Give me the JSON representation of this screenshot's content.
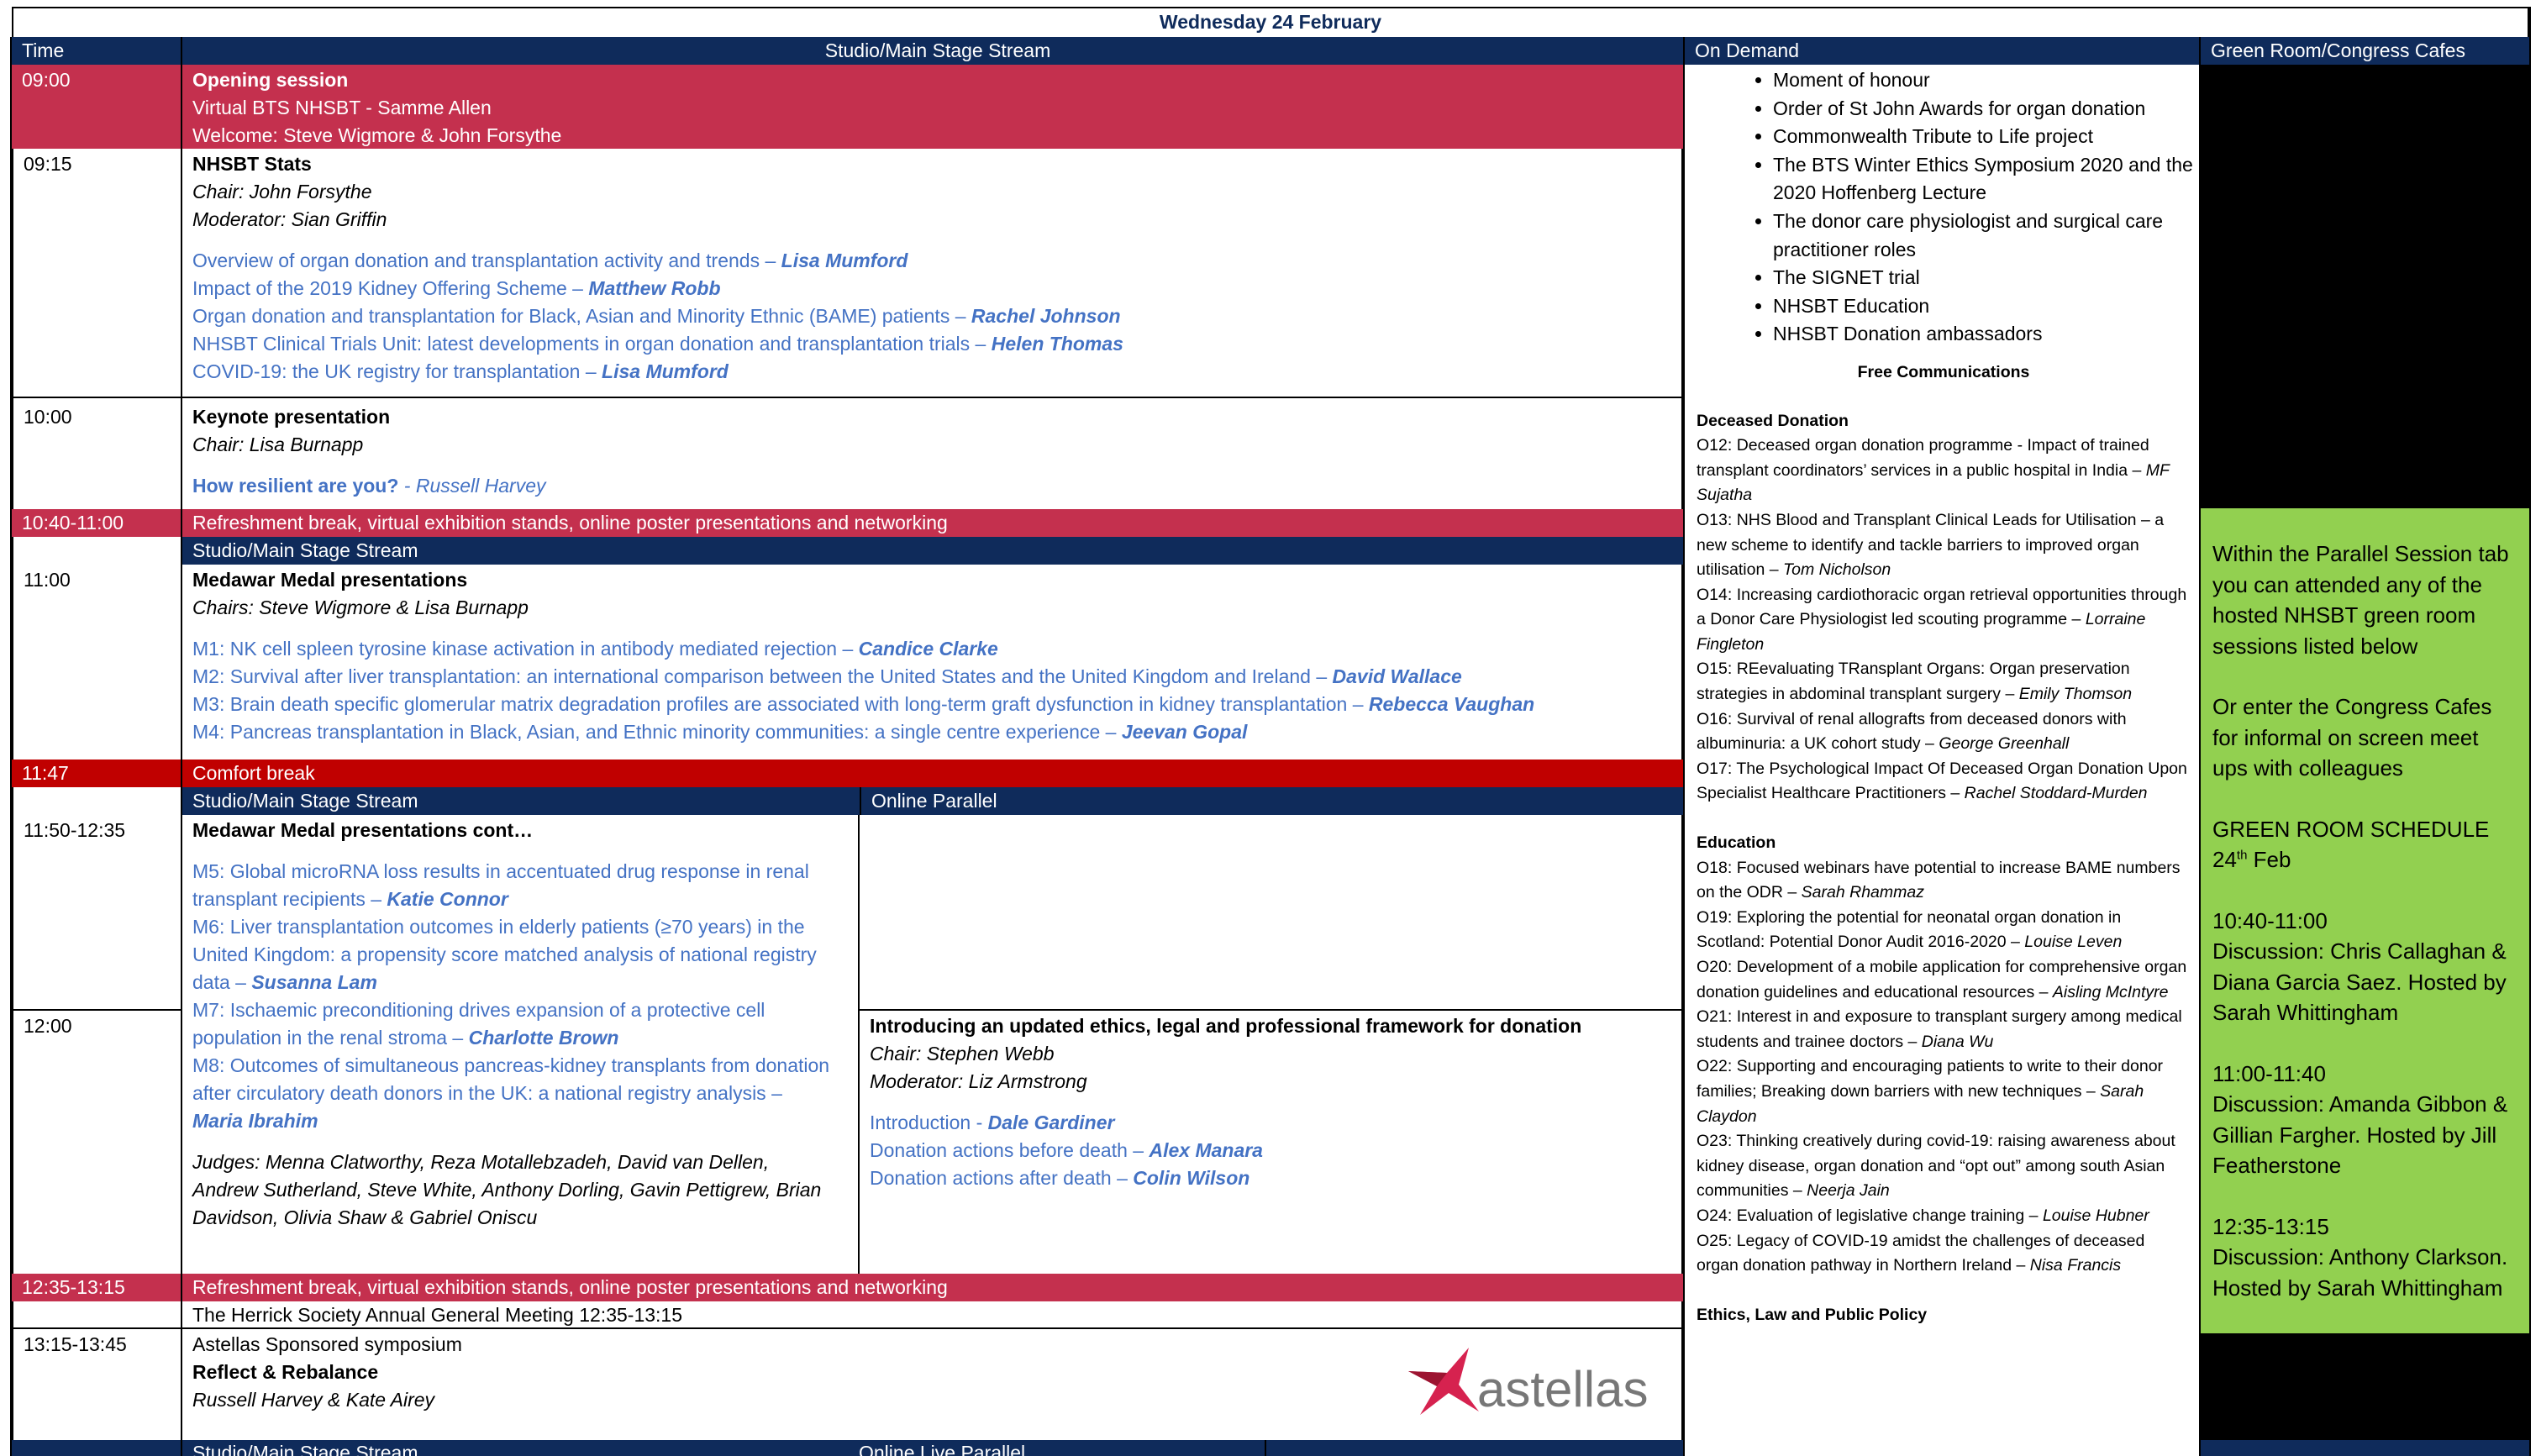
{
  "day_title": "Wednesday 24 February",
  "headers": {
    "time": "Time",
    "studio": "Studio/Main Stage Stream",
    "on_demand": "On Demand",
    "green_room": "Green Room/Congress Cafes",
    "online_parallel": "Online Parallel",
    "online_live_parallel": "Online Live Parallel"
  },
  "opening": {
    "time": "09:00",
    "title": "Opening session",
    "line1": "Virtual BTS NHSBT - Samme Allen",
    "line2": "Welcome: Steve Wigmore & John Forsythe"
  },
  "nhsbt": {
    "time": "09:15",
    "title": "NHSBT Stats",
    "chair": "Chair: John Forsythe",
    "moderator": "Moderator: Sian Griffin",
    "talks": [
      {
        "text": "Overview of organ donation and transplantation activity and trends – ",
        "speaker": "Lisa Mumford"
      },
      {
        "text": "Impact of the 2019 Kidney Offering Scheme – ",
        "speaker": "Matthew Robb"
      },
      {
        "text": "Organ donation and transplantation for Black, Asian and Minority Ethnic (BAME) patients – ",
        "speaker": "Rachel Johnson"
      },
      {
        "text": "NHSBT Clinical Trials Unit: latest developments in organ donation and transplantation trials – ",
        "speaker": "Helen Thomas"
      },
      {
        "text": "COVID-19: the UK registry for transplantation – ",
        "speaker": "Lisa Mumford"
      }
    ]
  },
  "keynote": {
    "time": "10:00",
    "title": "Keynote presentation",
    "chair": "Chair: Lisa Burnapp",
    "talk": "How resilient are you?",
    "speaker": " - Russell Harvey"
  },
  "break1": {
    "time": "10:40-11:00",
    "text": "Refreshment break, virtual exhibition stands, online poster presentations and networking"
  },
  "medawar": {
    "time": "11:00",
    "title": "Medawar Medal presentations",
    "chairs": "Chairs: Steve Wigmore & Lisa Burnapp",
    "talks": [
      {
        "text": "M1: NK cell spleen tyrosine kinase activation in antibody mediated rejection – ",
        "speaker": "Candice Clarke"
      },
      {
        "text": "M2: Survival after liver transplantation: an international comparison between the United States and the United Kingdom and Ireland – ",
        "speaker": "David Wallace"
      },
      {
        "text": "M3: Brain death specific glomerular matrix degradation profiles are associated with long-term graft dysfunction in kidney transplantation – ",
        "speaker": "Rebecca Vaughan"
      },
      {
        "text": "M4: Pancreas transplantation in Black, Asian, and Ethnic minority communities: a single centre experience – ",
        "speaker": "Jeevan Gopal"
      }
    ]
  },
  "comfort": {
    "time": "11:47",
    "text": "Comfort break"
  },
  "medawar2": {
    "time": "11:50-12:35",
    "time2": "12:00",
    "title": "Medawar Medal presentations cont…",
    "talks": [
      {
        "text": "M5: Global microRNA loss results in accentuated drug response in renal transplant recipients – ",
        "speaker": "Katie Connor"
      },
      {
        "text": "M6: Liver transplantation outcomes in elderly patients (≥70 years) in the United Kingdom: a propensity score matched analysis of national registry data – ",
        "speaker": "Susanna Lam"
      },
      {
        "text": "M7: Ischaemic preconditioning drives expansion of a protective cell population in the renal stroma – ",
        "speaker": "Charlotte Brown"
      },
      {
        "text": "M8: Outcomes of simultaneous pancreas-kidney transplants from donation after circulatory death donors in the UK: a national registry analysis – ",
        "speaker": "Maria Ibrahim"
      }
    ],
    "judges": "Judges: Menna Clatworthy, Reza Motallebzadeh, David van Dellen, Andrew Sutherland, Steve White, Anthony Dorling, Gavin Pettigrew, Brian Davidson, Olivia Shaw &  Gabriel Oniscu"
  },
  "ethics": {
    "title": "Introducing an updated ethics, legal and professional framework for donation",
    "chair": "Chair: Stephen Webb",
    "moderator": "Moderator: Liz Armstrong",
    "talks": [
      {
        "text": "Introduction - ",
        "speaker": "Dale Gardiner"
      },
      {
        "text": "Donation actions before death – ",
        "speaker": "Alex Manara"
      },
      {
        "text": "Donation actions after death – ",
        "speaker": "Colin Wilson"
      }
    ]
  },
  "break2": {
    "time": "12:35-13:15",
    "text": "Refreshment break, virtual exhibition stands, online poster presentations and networking"
  },
  "herrick": "The Herrick Society Annual General Meeting 12:35-13:15",
  "astellas": {
    "time": "13:15-13:45",
    "line1": "Astellas Sponsored symposium",
    "title": "Reflect & Rebalance",
    "speakers": "Russell Harvey & Kate Airey",
    "logo_text": "astellas",
    "logo_color": "#d6224f"
  },
  "on_demand": {
    "items": [
      "Moment of honour",
      "Order of St John Awards for organ donation",
      "Commonwealth Tribute to Life project",
      "The BTS Winter Ethics Symposium 2020 and the 2020 Hoffenberg Lecture",
      "The donor care physiologist and surgical care practitioner roles",
      "The SIGNET trial",
      "NHSBT Education",
      "NHSBT Donation ambassadors"
    ],
    "fc_title": "Free Communications",
    "deceased_title": "Deceased Donation",
    "deceased": [
      {
        "text": "O12: Deceased organ donation programme - Impact of trained transplant coordinators’ services in a public hospital in India – ",
        "author": "MF Sujatha"
      },
      {
        "text": "O13: NHS Blood and Transplant Clinical Leads for Utilisation – a new scheme to identify and tackle barriers to improved organ utilisation – ",
        "author": "Tom Nicholson"
      },
      {
        "text": "O14: Increasing cardiothoracic organ retrieval opportunities through a Donor Care Physiologist led scouting programme – ",
        "author": "Lorraine Fingleton"
      },
      {
        "text": "O15: REevaluating TRansplant Organs: Organ preservation strategies in abdominal transplant surgery – ",
        "author": "Emily Thomson"
      },
      {
        "text": "O16: Survival of renal allografts from deceased donors with albuminuria: a UK cohort study – ",
        "author": "George Greenhall"
      },
      {
        "text": "O17: The Psychological Impact Of Deceased Organ Donation Upon Specialist Healthcare Practitioners – ",
        "author": "Rachel Stoddard-Murden"
      }
    ],
    "education_title": "Education",
    "education": [
      {
        "text": "O18: Focused webinars have potential to increase BAME numbers on the ODR – ",
        "author": "Sarah Rhammaz"
      },
      {
        "text": "O19: Exploring the potential for neonatal organ donation in Scotland: Potential Donor Audit 2016-2020 – ",
        "author": "Louise Leven"
      },
      {
        "text": "O20: Development of a mobile application for comprehensive organ donation guidelines and educational resources – ",
        "author": "Aisling McIntyre"
      },
      {
        "text": "O21: Interest in and exposure to transplant surgery among medical students and trainee doctors – ",
        "author": "Diana Wu"
      },
      {
        "text": "O22: Supporting and encouraging patients to write to their donor families; Breaking down barriers with new techniques – ",
        "author": "Sarah Claydon"
      },
      {
        "text": "O23: Thinking creatively during covid-19: raising awareness about kidney disease, organ donation and “opt out” among south Asian communities – ",
        "author": "Neerja Jain"
      },
      {
        "text": "O24: Evaluation of legislative change training – ",
        "author": "Louise Hubner"
      },
      {
        "text": "O25: Legacy of COVID-19 amidst the challenges of deceased organ donation pathway in Northern Ireland – ",
        "author": "Nisa Francis"
      }
    ],
    "ethics_title": "Ethics, Law and Public Policy"
  },
  "green_room": {
    "p1": "Within the Parallel Session tab you can attended any of the hosted NHSBT green room sessions listed below",
    "p2": "Or enter the Congress Cafes for informal on screen meet ups with colleagues",
    "schedule_title": "GREEN ROOM SCHEDULE",
    "date_num": "24",
    "date_sup": "th",
    "date_month": " Feb",
    "s1_time": "10:40-11:00",
    "s1_text": "Discussion: Chris Callaghan & Diana Garcia Saez.  Hosted by Sarah Whittingham",
    "s2_time": "11:00-11:40",
    "s2_text": "Discussion: Amanda Gibbon & Gillian Fargher.  Hosted by Jill Featherstone",
    "s3_time": "12:35-13:15",
    "s3_text": "Discussion: Anthony Clarkson. Hosted by Sarah Whittingham",
    "colors": {
      "navy": "#0f2b5b",
      "red": "#c4304e",
      "dark_red": "#c00000",
      "green": "#92d050",
      "link_blue": "#4472c4"
    }
  }
}
